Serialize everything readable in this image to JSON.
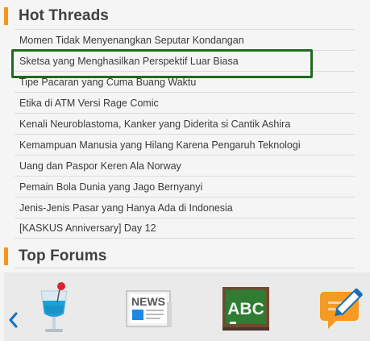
{
  "hot_threads": {
    "title": "Hot Threads",
    "items": [
      "Momen Tidak Menyenangkan Seputar Kondangan",
      "Sketsa yang Menghasilkan Perspektif Luar Biasa",
      "Tipe Pacaran yang Cuma Buang Waktu",
      "Etika di ATM Versi Rage Comic",
      "Kenali Neuroblastoma, Kanker yang Diderita si Cantik Ashira",
      "Kemampuan Manusia yang Hilang Karena Pengaruh Teknologi",
      "Uang dan Paspor Keren Ala Norway",
      "Pemain Bola Dunia yang Jago Bernyanyi",
      "Jenis-Jenis Pasar yang Hanya Ada di Indonesia",
      "[KASKUS Anniversary] Day 12"
    ]
  },
  "top_forums": {
    "title": "Top Forums",
    "icons": [
      "drink-glass-icon",
      "news-icon",
      "abc-board-icon",
      "write-pencil-icon"
    ],
    "news_icon_text": "NEWS",
    "abc_icon_text": "ABC"
  },
  "colors": {
    "accent_bar": "#f7941d",
    "highlight_border": "#1f6b1f",
    "chevron": "#1a6fb5"
  }
}
